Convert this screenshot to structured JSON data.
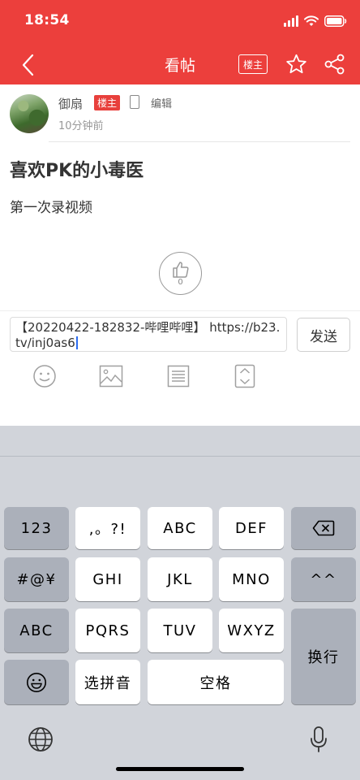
{
  "status_bar": {
    "time": "18:54"
  },
  "header": {
    "title": "看帖",
    "owner_toggle": "楼主"
  },
  "post": {
    "author": "御扇",
    "owner_badge": "楼主",
    "edit_label": "编辑",
    "time_ago": "10分钟前",
    "title": "喜欢PK的小毒医",
    "body": "第一次录视频",
    "like_count": "0"
  },
  "composer": {
    "input_value": "【20220422-182832-哔哩哔哩】 https://b23.tv/inj0as6",
    "send_label": "发送"
  },
  "keyboard": {
    "row1": [
      "123",
      ",。?!",
      "ABC",
      "DEF"
    ],
    "row2": [
      "#@¥",
      "GHI",
      "JKL",
      "MNO",
      "^^"
    ],
    "row3": [
      "ABC",
      "PQRS",
      "TUV",
      "WXYZ"
    ],
    "return_label": "换行",
    "pinyin_label": "选拼音",
    "space_label": "空格"
  },
  "colors": {
    "brand_red": "#ec3f3c",
    "caret_blue": "#2c6cf0"
  }
}
